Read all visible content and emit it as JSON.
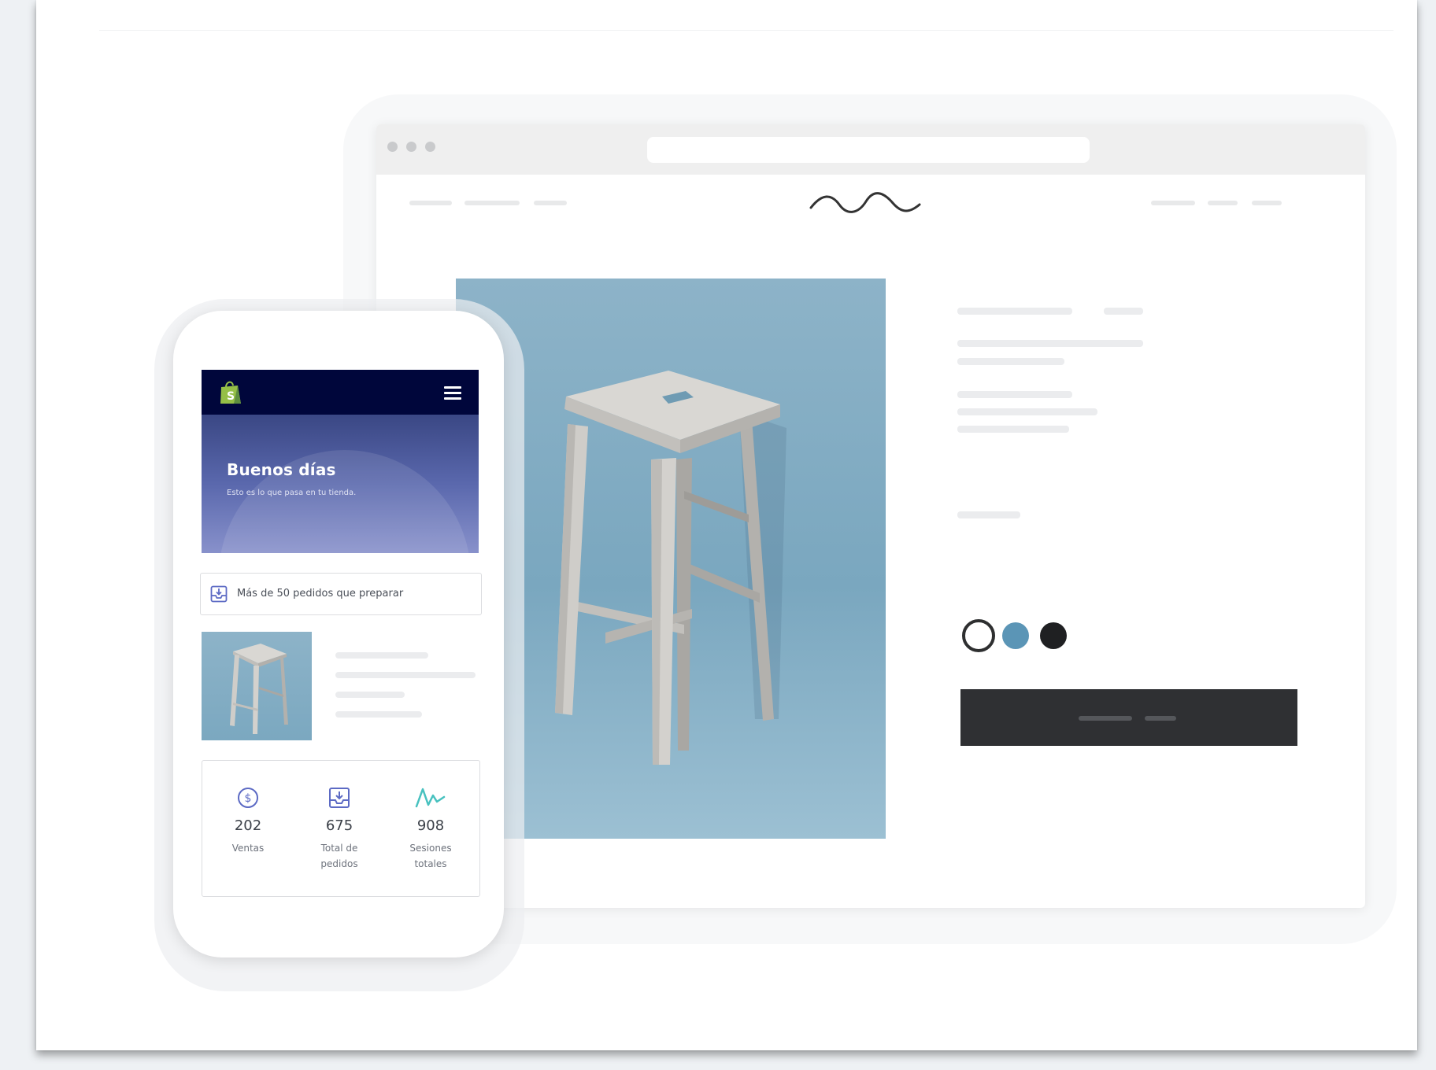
{
  "phone": {
    "greeting_title": "Buenos días",
    "greeting_subtitle": "Esto es lo que pasa en tu tienda.",
    "orders_alert": "Más de 50 pedidos que preparar",
    "stats": [
      {
        "icon": "dollar-icon",
        "value": "202",
        "label": "Ventas"
      },
      {
        "icon": "orders-icon",
        "value": "675",
        "label": "Total de pedidos"
      },
      {
        "icon": "sessions-chart-icon",
        "value": "908",
        "label": "Sesiones totales"
      }
    ]
  },
  "browser": {
    "swatches": [
      "#ffffff",
      "#5b95b6",
      "#1f2022"
    ],
    "button_color": "#2f3033"
  },
  "colors": {
    "brand_green": "#95bf47",
    "header_navy": "#00063b",
    "accent_teal": "#47c1bf",
    "icon_blue": "#5c6ac4"
  }
}
